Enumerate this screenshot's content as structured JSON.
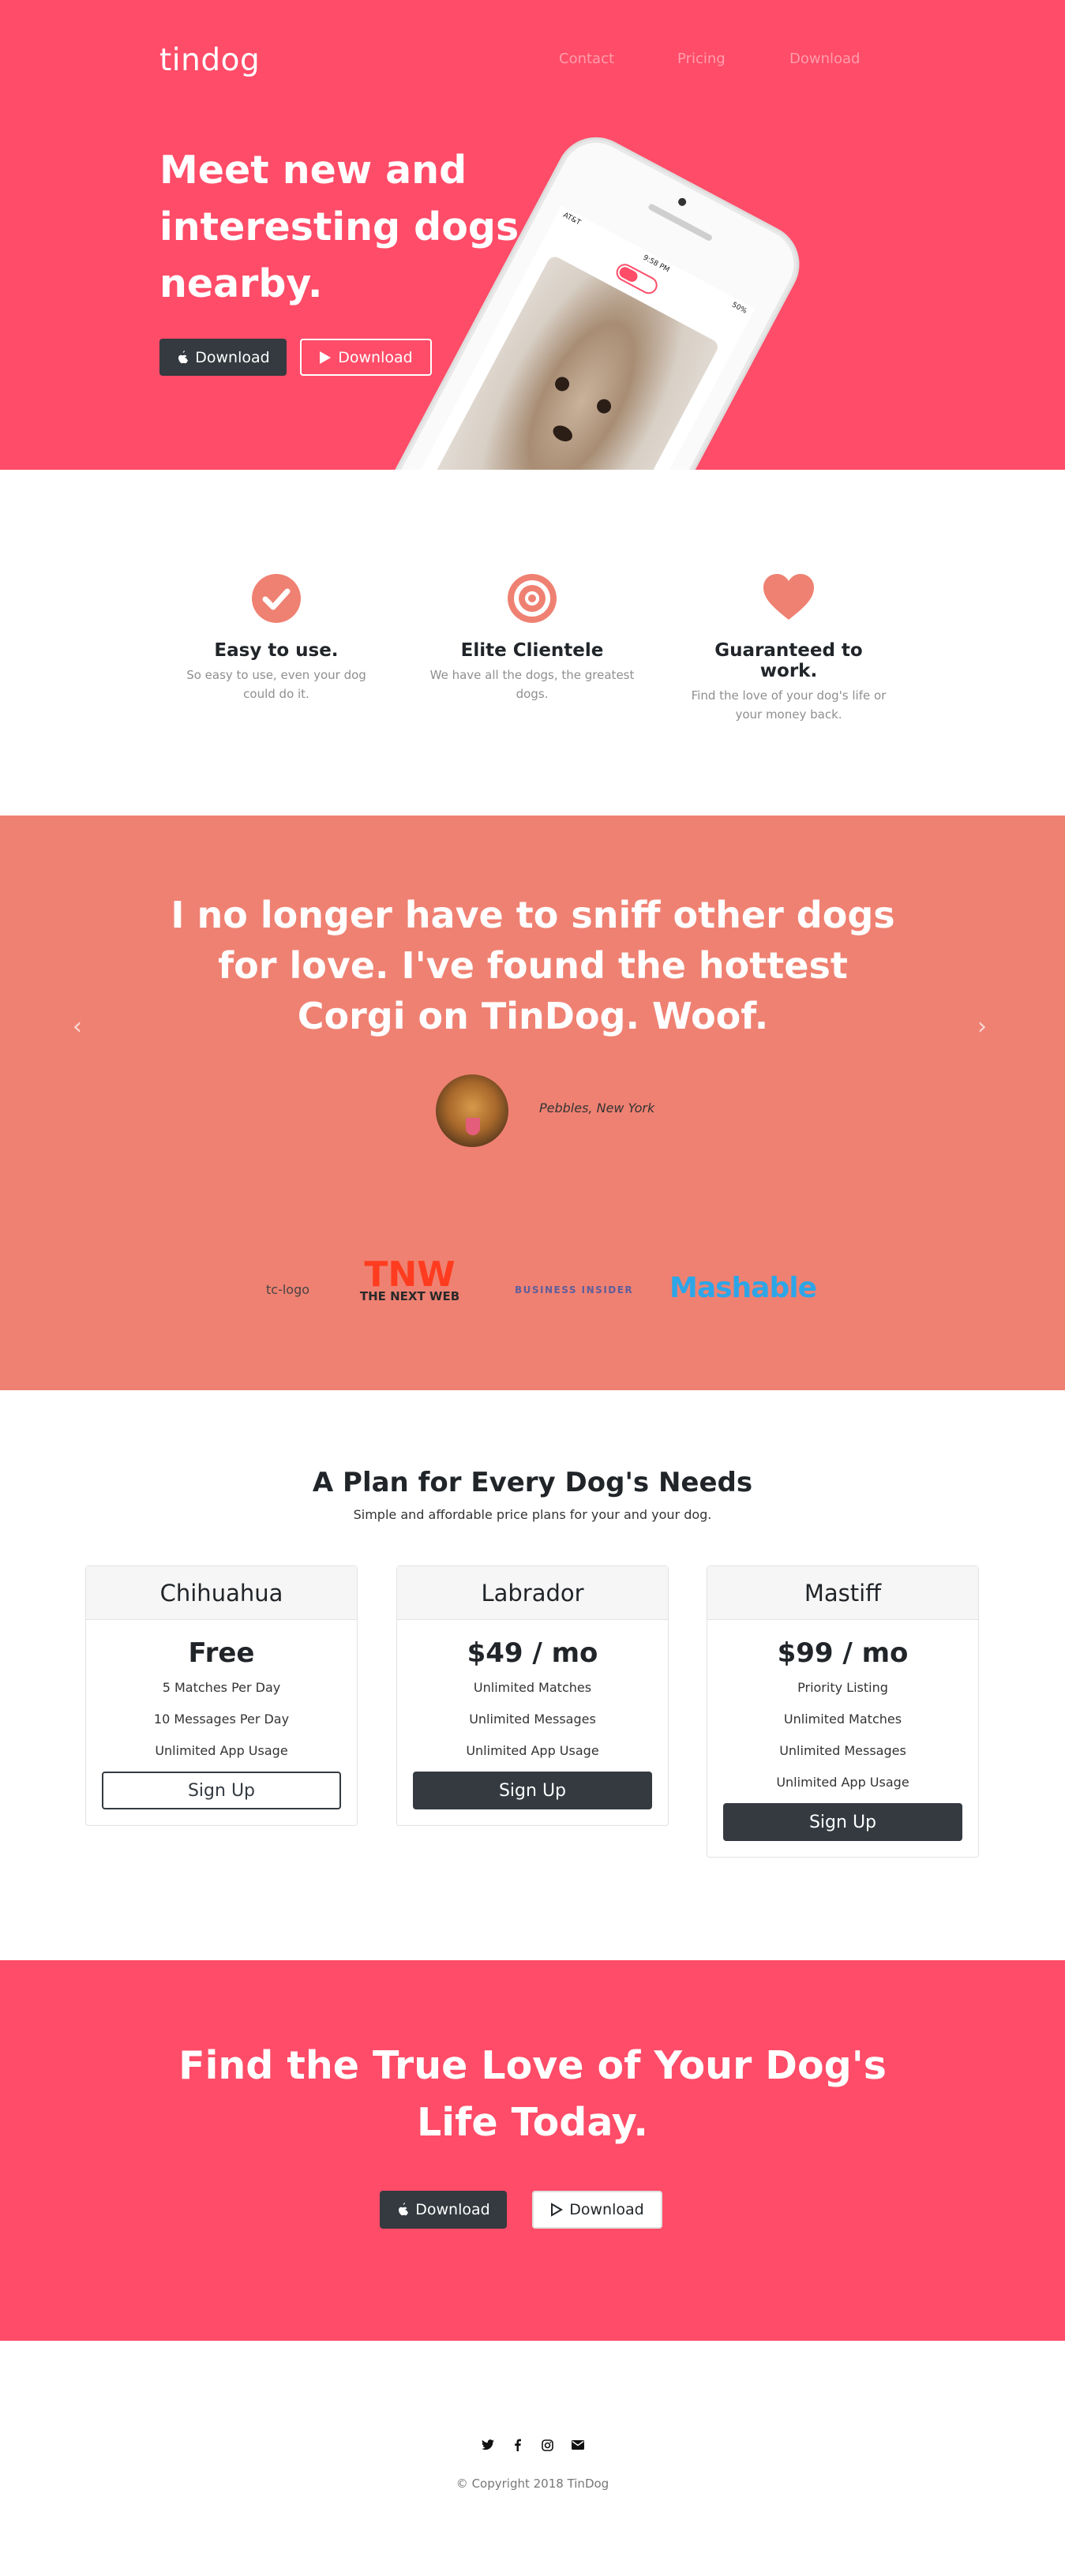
{
  "colors": {
    "primary": "#ff4c68",
    "secondary": "#ef8172",
    "dark": "#343a40"
  },
  "nav": {
    "brand": "tindog",
    "links": [
      "Contact",
      "Pricing",
      "Download"
    ]
  },
  "hero": {
    "title": "Meet new and interesting dogs nearby.",
    "buttons": [
      {
        "label": "Download",
        "icon": "apple-icon"
      },
      {
        "label": "Download",
        "icon": "google-play-icon"
      }
    ],
    "phone": {
      "carrier": "AT&T",
      "time": "9:58 PM",
      "battery": "50%"
    }
  },
  "features": [
    {
      "icon": "check-circle-icon",
      "title": "Easy to use.",
      "text": "So easy to use, even your dog could do it."
    },
    {
      "icon": "bullseye-icon",
      "title": "Elite Clientele",
      "text": "We have all the dogs, the greatest dogs."
    },
    {
      "icon": "heart-icon",
      "title": "Guaranteed to work.",
      "text": "Find the love of your dog's life or your money back."
    }
  ],
  "testimonial": {
    "quote": "I no longer have to sniff other dogs for love. I've found the hottest Corgi on TinDog. Woof.",
    "author": "Pebbles, New York"
  },
  "press": {
    "tc": "tc-logo",
    "tnw_mark": "TNW",
    "tnw_name": "THE NEXT WEB",
    "bi": "BUSINESS INSIDER",
    "mashable": "Mashable"
  },
  "pricing": {
    "title": "A Plan for Every Dog's Needs",
    "subtitle": "Simple and affordable price plans for your and your dog.",
    "plans": [
      {
        "name": "Chihuahua",
        "price": "Free",
        "features": [
          "5 Matches Per Day",
          "10 Messages Per Day",
          "Unlimited App Usage"
        ],
        "button": "Sign Up"
      },
      {
        "name": "Labrador",
        "price": "$49 / mo",
        "features": [
          "Unlimited Matches",
          "Unlimited Messages",
          "Unlimited App Usage"
        ],
        "button": "Sign Up"
      },
      {
        "name": "Mastiff",
        "price": "$99 / mo",
        "features": [
          "Priority Listing",
          "Unlimited Matches",
          "Unlimited Messages",
          "Unlimited App Usage"
        ],
        "button": "Sign Up"
      }
    ]
  },
  "cta": {
    "title": "Find the True Love of Your Dog's Life Today.",
    "buttons": [
      {
        "label": "Download",
        "icon": "apple-icon"
      },
      {
        "label": "Download",
        "icon": "google-play-icon"
      }
    ]
  },
  "footer": {
    "social": [
      "twitter-icon",
      "facebook-icon",
      "instagram-icon",
      "envelope-icon"
    ],
    "copyright": "© Copyright 2018 TinDog"
  }
}
